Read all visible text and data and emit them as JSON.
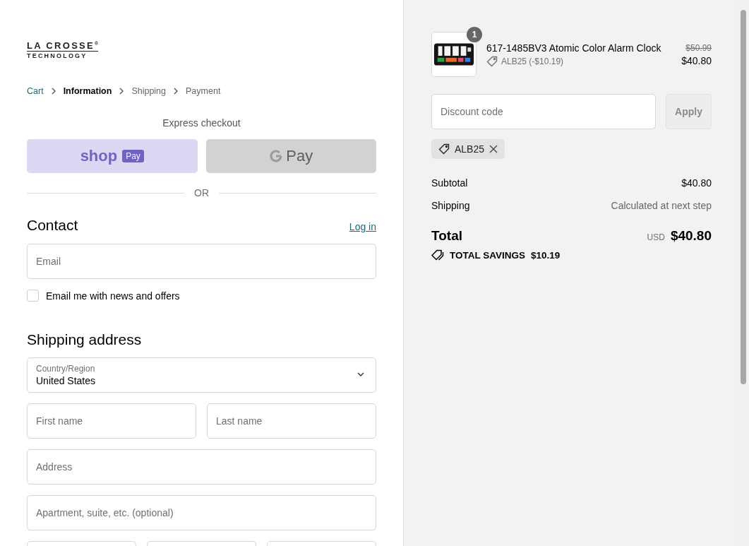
{
  "logo": {
    "line_1": "LA CROSSE",
    "mark": "®",
    "line_2": "TECHNOLOGY"
  },
  "breadcrumbs": [
    {
      "label": "Cart",
      "kind": "link"
    },
    {
      "label": "Information",
      "kind": "current"
    },
    {
      "label": "Shipping",
      "kind": "upcoming"
    },
    {
      "label": "Payment",
      "kind": "upcoming"
    }
  ],
  "express_checkout": {
    "title": "Express checkout",
    "buttons": [
      {
        "kind": "shop_pay",
        "label": "shop",
        "badge": "Pay"
      },
      {
        "kind": "google_pay",
        "label": "Pay"
      }
    ]
  },
  "divider_label": "OR",
  "contact": {
    "title": "Contact",
    "login_link": "Log in",
    "email_placeholder": "Email",
    "newsletter": {
      "label": "Email me with news and offers",
      "checked": false
    }
  },
  "shipping_address": {
    "title": "Shipping address",
    "rows": [
      [
        {
          "kind": "select",
          "label": "Country/Region",
          "value": "United States"
        }
      ],
      [
        {
          "kind": "input",
          "placeholder": "First name"
        },
        {
          "kind": "input",
          "placeholder": "Last name"
        }
      ],
      [
        {
          "kind": "input",
          "placeholder": "Address"
        }
      ],
      [
        {
          "kind": "input",
          "placeholder": "Apartment, suite, etc. (optional)"
        }
      ],
      [
        {
          "kind": "input"
        },
        {
          "kind": "input"
        },
        {
          "kind": "input"
        }
      ]
    ]
  },
  "order_summary": {
    "items": [
      {
        "quantity": "1",
        "name": "617-1485BV3 Atomic Color Alarm Clock",
        "discount": "ALB25 (-$10.19)",
        "original_price": "$50.99",
        "price": "$40.80"
      }
    ],
    "discount_placeholder": "Discount code",
    "apply_button": "Apply",
    "applied_codes": [
      {
        "code": "ALB25"
      }
    ],
    "lines": [
      {
        "label": "Subtotal",
        "value": "$40.80",
        "kind": "amount"
      },
      {
        "label": "Shipping",
        "value": "Calculated at next step",
        "kind": "note"
      }
    ],
    "total": {
      "label": "Total",
      "currency": "USD",
      "amount": "$40.80"
    },
    "savings": {
      "label": "TOTAL SAVINGS",
      "amount": "$10.19"
    }
  }
}
